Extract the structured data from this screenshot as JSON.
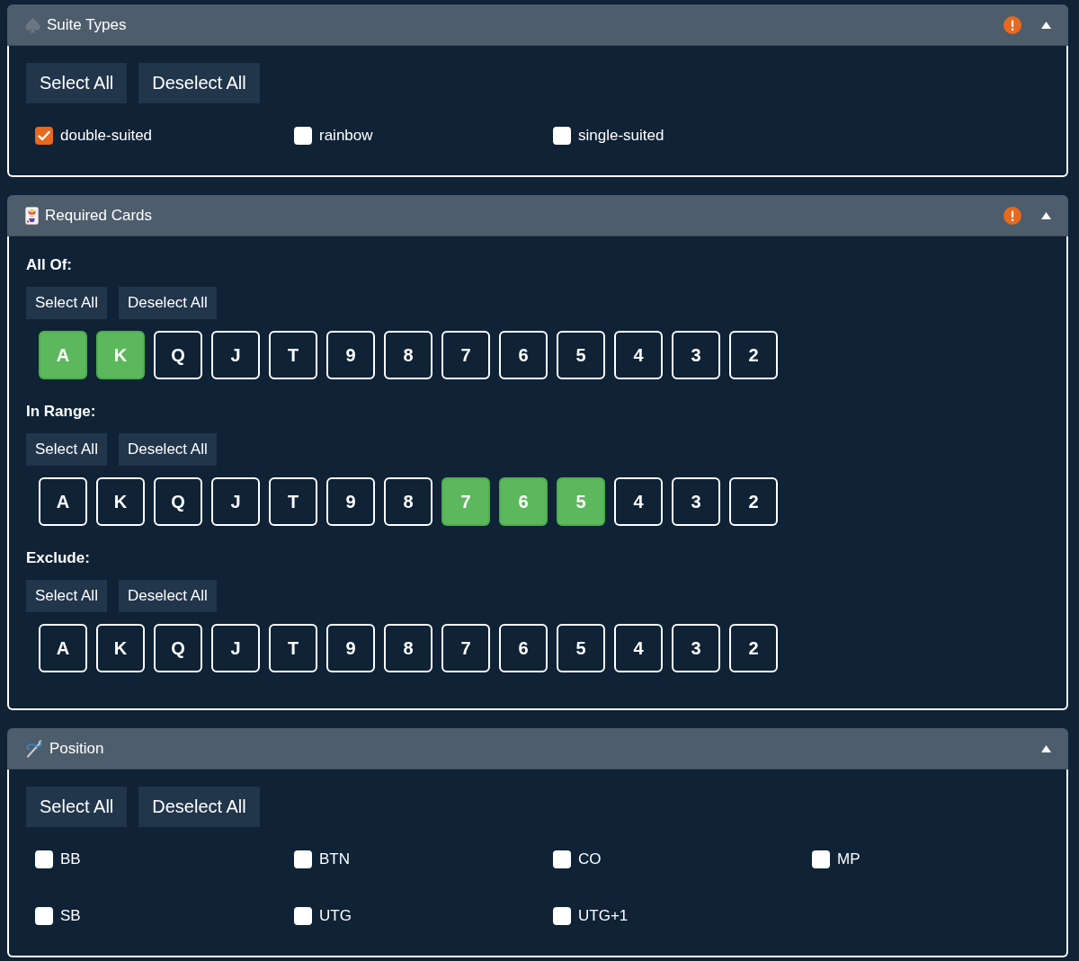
{
  "panels": [
    {
      "kind": "checkboxes",
      "title": "Suite Types",
      "warning": true,
      "expanded": true,
      "buttons": [
        "Select All",
        "Deselect All"
      ],
      "options": [
        {
          "label": "double-suited",
          "checked": true
        },
        {
          "label": "rainbow",
          "checked": false
        },
        {
          "label": "single-suited",
          "checked": false
        }
      ]
    },
    {
      "kind": "cards",
      "title": "Required Cards",
      "warning": true,
      "expanded": true,
      "groups": [
        {
          "label": "All Of:",
          "buttons": [
            "Select All",
            "Deselect All"
          ],
          "cards": [
            {
              "rank": "A",
              "selected": true
            },
            {
              "rank": "K",
              "selected": true
            },
            {
              "rank": "Q",
              "selected": false
            },
            {
              "rank": "J",
              "selected": false
            },
            {
              "rank": "T",
              "selected": false
            },
            {
              "rank": "9",
              "selected": false
            },
            {
              "rank": "8",
              "selected": false
            },
            {
              "rank": "7",
              "selected": false
            },
            {
              "rank": "6",
              "selected": false
            },
            {
              "rank": "5",
              "selected": false
            },
            {
              "rank": "4",
              "selected": false
            },
            {
              "rank": "3",
              "selected": false
            },
            {
              "rank": "2",
              "selected": false
            }
          ]
        },
        {
          "label": "In Range:",
          "buttons": [
            "Select All",
            "Deselect All"
          ],
          "cards": [
            {
              "rank": "A",
              "selected": false
            },
            {
              "rank": "K",
              "selected": false
            },
            {
              "rank": "Q",
              "selected": false
            },
            {
              "rank": "J",
              "selected": false
            },
            {
              "rank": "T",
              "selected": false
            },
            {
              "rank": "9",
              "selected": false
            },
            {
              "rank": "8",
              "selected": false
            },
            {
              "rank": "7",
              "selected": true
            },
            {
              "rank": "6",
              "selected": true
            },
            {
              "rank": "5",
              "selected": true
            },
            {
              "rank": "4",
              "selected": false
            },
            {
              "rank": "3",
              "selected": false
            },
            {
              "rank": "2",
              "selected": false
            }
          ]
        },
        {
          "label": "Exclude:",
          "buttons": [
            "Select All",
            "Deselect All"
          ],
          "cards": [
            {
              "rank": "A",
              "selected": false
            },
            {
              "rank": "K",
              "selected": false
            },
            {
              "rank": "Q",
              "selected": false
            },
            {
              "rank": "J",
              "selected": false
            },
            {
              "rank": "T",
              "selected": false
            },
            {
              "rank": "9",
              "selected": false
            },
            {
              "rank": "8",
              "selected": false
            },
            {
              "rank": "7",
              "selected": false
            },
            {
              "rank": "6",
              "selected": false
            },
            {
              "rank": "5",
              "selected": false
            },
            {
              "rank": "4",
              "selected": false
            },
            {
              "rank": "3",
              "selected": false
            },
            {
              "rank": "2",
              "selected": false
            }
          ]
        }
      ]
    },
    {
      "kind": "checkboxes",
      "title": "Position",
      "warning": false,
      "expanded": true,
      "buttons": [
        "Select All",
        "Deselect All"
      ],
      "options": [
        {
          "label": "BB",
          "checked": false
        },
        {
          "label": "BTN",
          "checked": false
        },
        {
          "label": "CO",
          "checked": false
        },
        {
          "label": "MP",
          "checked": false
        },
        {
          "label": "SB",
          "checked": false
        },
        {
          "label": "UTG",
          "checked": false
        },
        {
          "label": "UTG+1",
          "checked": false
        }
      ]
    }
  ]
}
